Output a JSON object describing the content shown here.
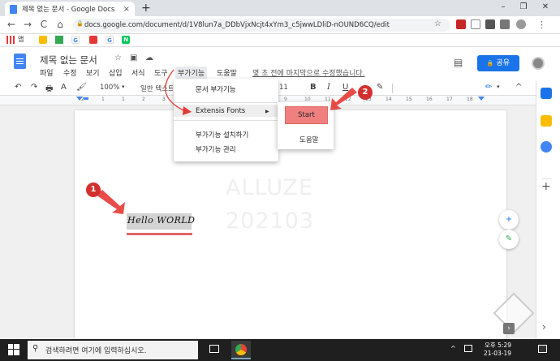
{
  "browser": {
    "tab_title": "제목 없는 문서 - Google Docs",
    "tab_close": "×",
    "new_tab": "+",
    "win_min": "–",
    "win_max": "❐",
    "win_close": "✕",
    "url": "docs.google.com/document/d/1V8lun7a_DDbVjxNcjt4xYm3_c5jwwLDliD-nOUND6CQ/edit",
    "back": "←",
    "forward": "→",
    "reload": "C",
    "home": "⌂",
    "star": "☆",
    "menu_dots": "⋮",
    "apps_label": "앱"
  },
  "docs": {
    "title": "제목 없는 문서",
    "menus": [
      "파일",
      "수정",
      "보기",
      "삽입",
      "서식",
      "도구",
      "부가기능",
      "도움말"
    ],
    "last_edit": "몇 초 전에 마지막으로 수정했습니다.",
    "share_label": "공유",
    "share_icon": "🔒"
  },
  "toolbar": {
    "undo": "↶",
    "redo": "↷",
    "print": "🖶",
    "zoom": "100%",
    "zoom_arrow": "▾",
    "style_partial": "일반 텍스트",
    "font_size_partial": "11",
    "bold": "B",
    "italic": "I",
    "underline": "U",
    "color_a": "A",
    "highlighter": "✎",
    "edit_mode": "✏",
    "collapse": "^",
    "more": "⋮"
  },
  "ruler": {
    "marks": [
      "2",
      "1",
      "1",
      "2",
      "3",
      "4",
      "5",
      "6",
      "7",
      "8",
      "9",
      "10",
      "11",
      "12",
      "13",
      "14",
      "15",
      "16",
      "17",
      "18"
    ]
  },
  "document": {
    "watermark_line1": "ALLUZE",
    "watermark_line2": "202103",
    "content_text": "Hello WORLD"
  },
  "addon_menu": {
    "items": {
      "document_addons": "문서 부가기능",
      "extensis_fonts": "Extensis Fonts",
      "install_addons": "부가기능 설치하기",
      "manage_addons": "부가기능 관리"
    },
    "submenu_arrow": "▶"
  },
  "submenu": {
    "start": "Start",
    "help": "도움말"
  },
  "callouts": {
    "step1": "1",
    "step2": "2"
  },
  "floating": {
    "add_comment": "+",
    "suggest": "✎"
  },
  "sidepanel": {
    "add": "+",
    "expand": "›"
  },
  "taskbar": {
    "search_placeholder": "검색하려면 여기에 입력하십시오.",
    "time": "오후 5:29",
    "date": "21-03-19"
  },
  "colors": {
    "accent_blue": "#1a73e8",
    "callout_red": "#d32f2f",
    "start_button": "#f08080",
    "underline_red": "#e06666"
  }
}
